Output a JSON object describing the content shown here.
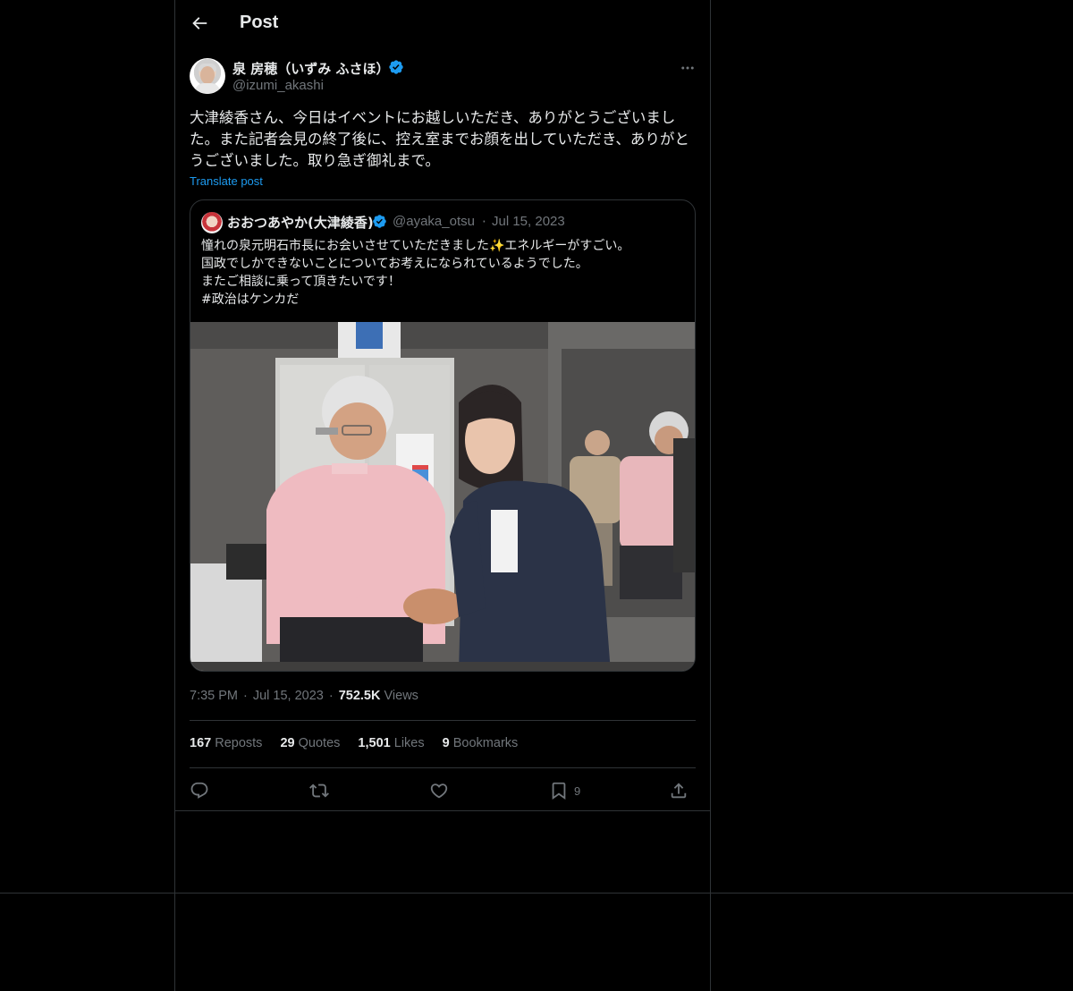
{
  "header": {
    "title": "Post"
  },
  "post": {
    "author_name": "泉 房穂（いずみ ふさほ）",
    "author_handle": "@izumi_akashi",
    "text": "大津綾香さん、今日はイベントにお越しいただき、ありがとうございました。また記者会見の終了後に、控え室までお顔を出していただき、ありがとうございました。取り急ぎ御礼まで。",
    "translate_label": "Translate post",
    "time": "7:35 PM",
    "date": "Jul 15, 2023",
    "views_count": "752.5K",
    "views_label": "Views"
  },
  "quoted_post": {
    "author_name": "おおつあやか(大津綾香)",
    "author_handle": "@ayaka_otsu",
    "date": "Jul 15, 2023",
    "text": "憧れの泉元明石市長にお会いさせていただきました✨エネルギーがすごい。\n国政でしかできないことについてお考えになられているようでした。\nまたご相談に乗って頂きたいです！\n#政治はケンカだ"
  },
  "stats": {
    "reposts_count": "167",
    "reposts_label": "Reposts",
    "quotes_count": "29",
    "quotes_label": "Quotes",
    "likes_count": "1,501",
    "likes_label": "Likes",
    "bookmarks_count": "9",
    "bookmarks_label": "Bookmarks"
  },
  "actions": {
    "reply_icon": "reply-icon",
    "repost_icon": "repost-icon",
    "like_icon": "heart-icon",
    "bookmark_icon": "bookmark-icon",
    "bookmark_count": "9",
    "share_icon": "share-icon"
  },
  "colors": {
    "background": "#000000",
    "text": "#e7e9ea",
    "secondary": "#71767b",
    "accent": "#1d9bf0",
    "border": "#2f3336"
  }
}
